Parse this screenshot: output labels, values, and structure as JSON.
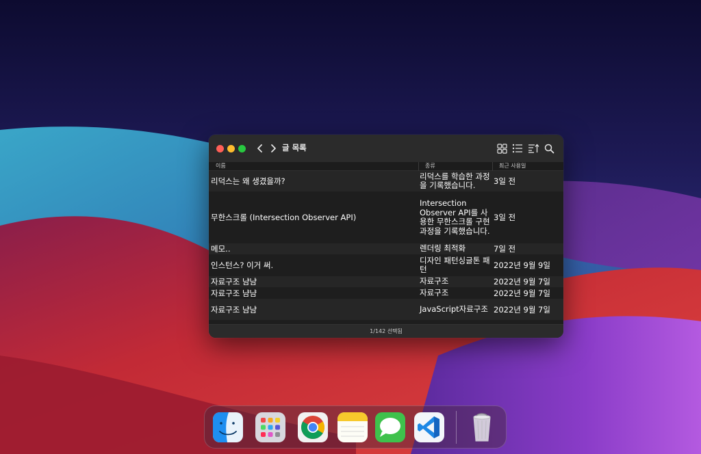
{
  "window": {
    "title": "글 목록"
  },
  "columns": {
    "name": "이름",
    "kind": "종류",
    "date": "최근 사용일"
  },
  "rows": [
    {
      "name": "리덕스는 왜 생겼을까?",
      "kind": "리덕스를 학습한 과정을 기록했습니다.",
      "date": "3일 전"
    },
    {
      "name": "무한스크롤 (Intersection Observer API)",
      "kind": "Intersection Observer API를 사용한 무한스크롤 구현 과정을 기록했습니다.",
      "date": "3일 전"
    },
    {
      "name": "메모..",
      "kind": "렌더링 최적화",
      "date": "7일 전"
    },
    {
      "name": "인스턴스? 이거 써.",
      "kind": "디자인 패턴싱글톤 패턴",
      "date": "2022년 9월 9일"
    },
    {
      "name": "자료구조 냠냠",
      "kind": "자료구조",
      "date": "2022년 9월 7일"
    },
    {
      "name": "자료구조 냠냠",
      "kind": "자료구조",
      "date": "2022년 9월 7일"
    },
    {
      "name": "자료구조 냠냠",
      "kind": "JavaScript자료구조",
      "date": "2022년 9월 7일"
    }
  ],
  "status": {
    "text": "1/142 선택됨"
  },
  "icons": {
    "back": "chevron-left-icon",
    "forward": "chevron-right-icon",
    "grid_view": "grid-view-icon",
    "list_view": "list-view-icon",
    "sort": "sort-icon",
    "search": "search-icon"
  },
  "dock": {
    "apps": [
      "finder-icon",
      "launchpad-icon",
      "chrome-icon",
      "notes-icon",
      "messages-icon",
      "vscode-icon",
      "trash-icon"
    ]
  },
  "colors": {
    "close": "#ff5f57",
    "minimize": "#febc2e",
    "maximize": "#28c840",
    "window_bg": "#1e1e1e",
    "titlebar_bg": "#2b2b2b"
  }
}
